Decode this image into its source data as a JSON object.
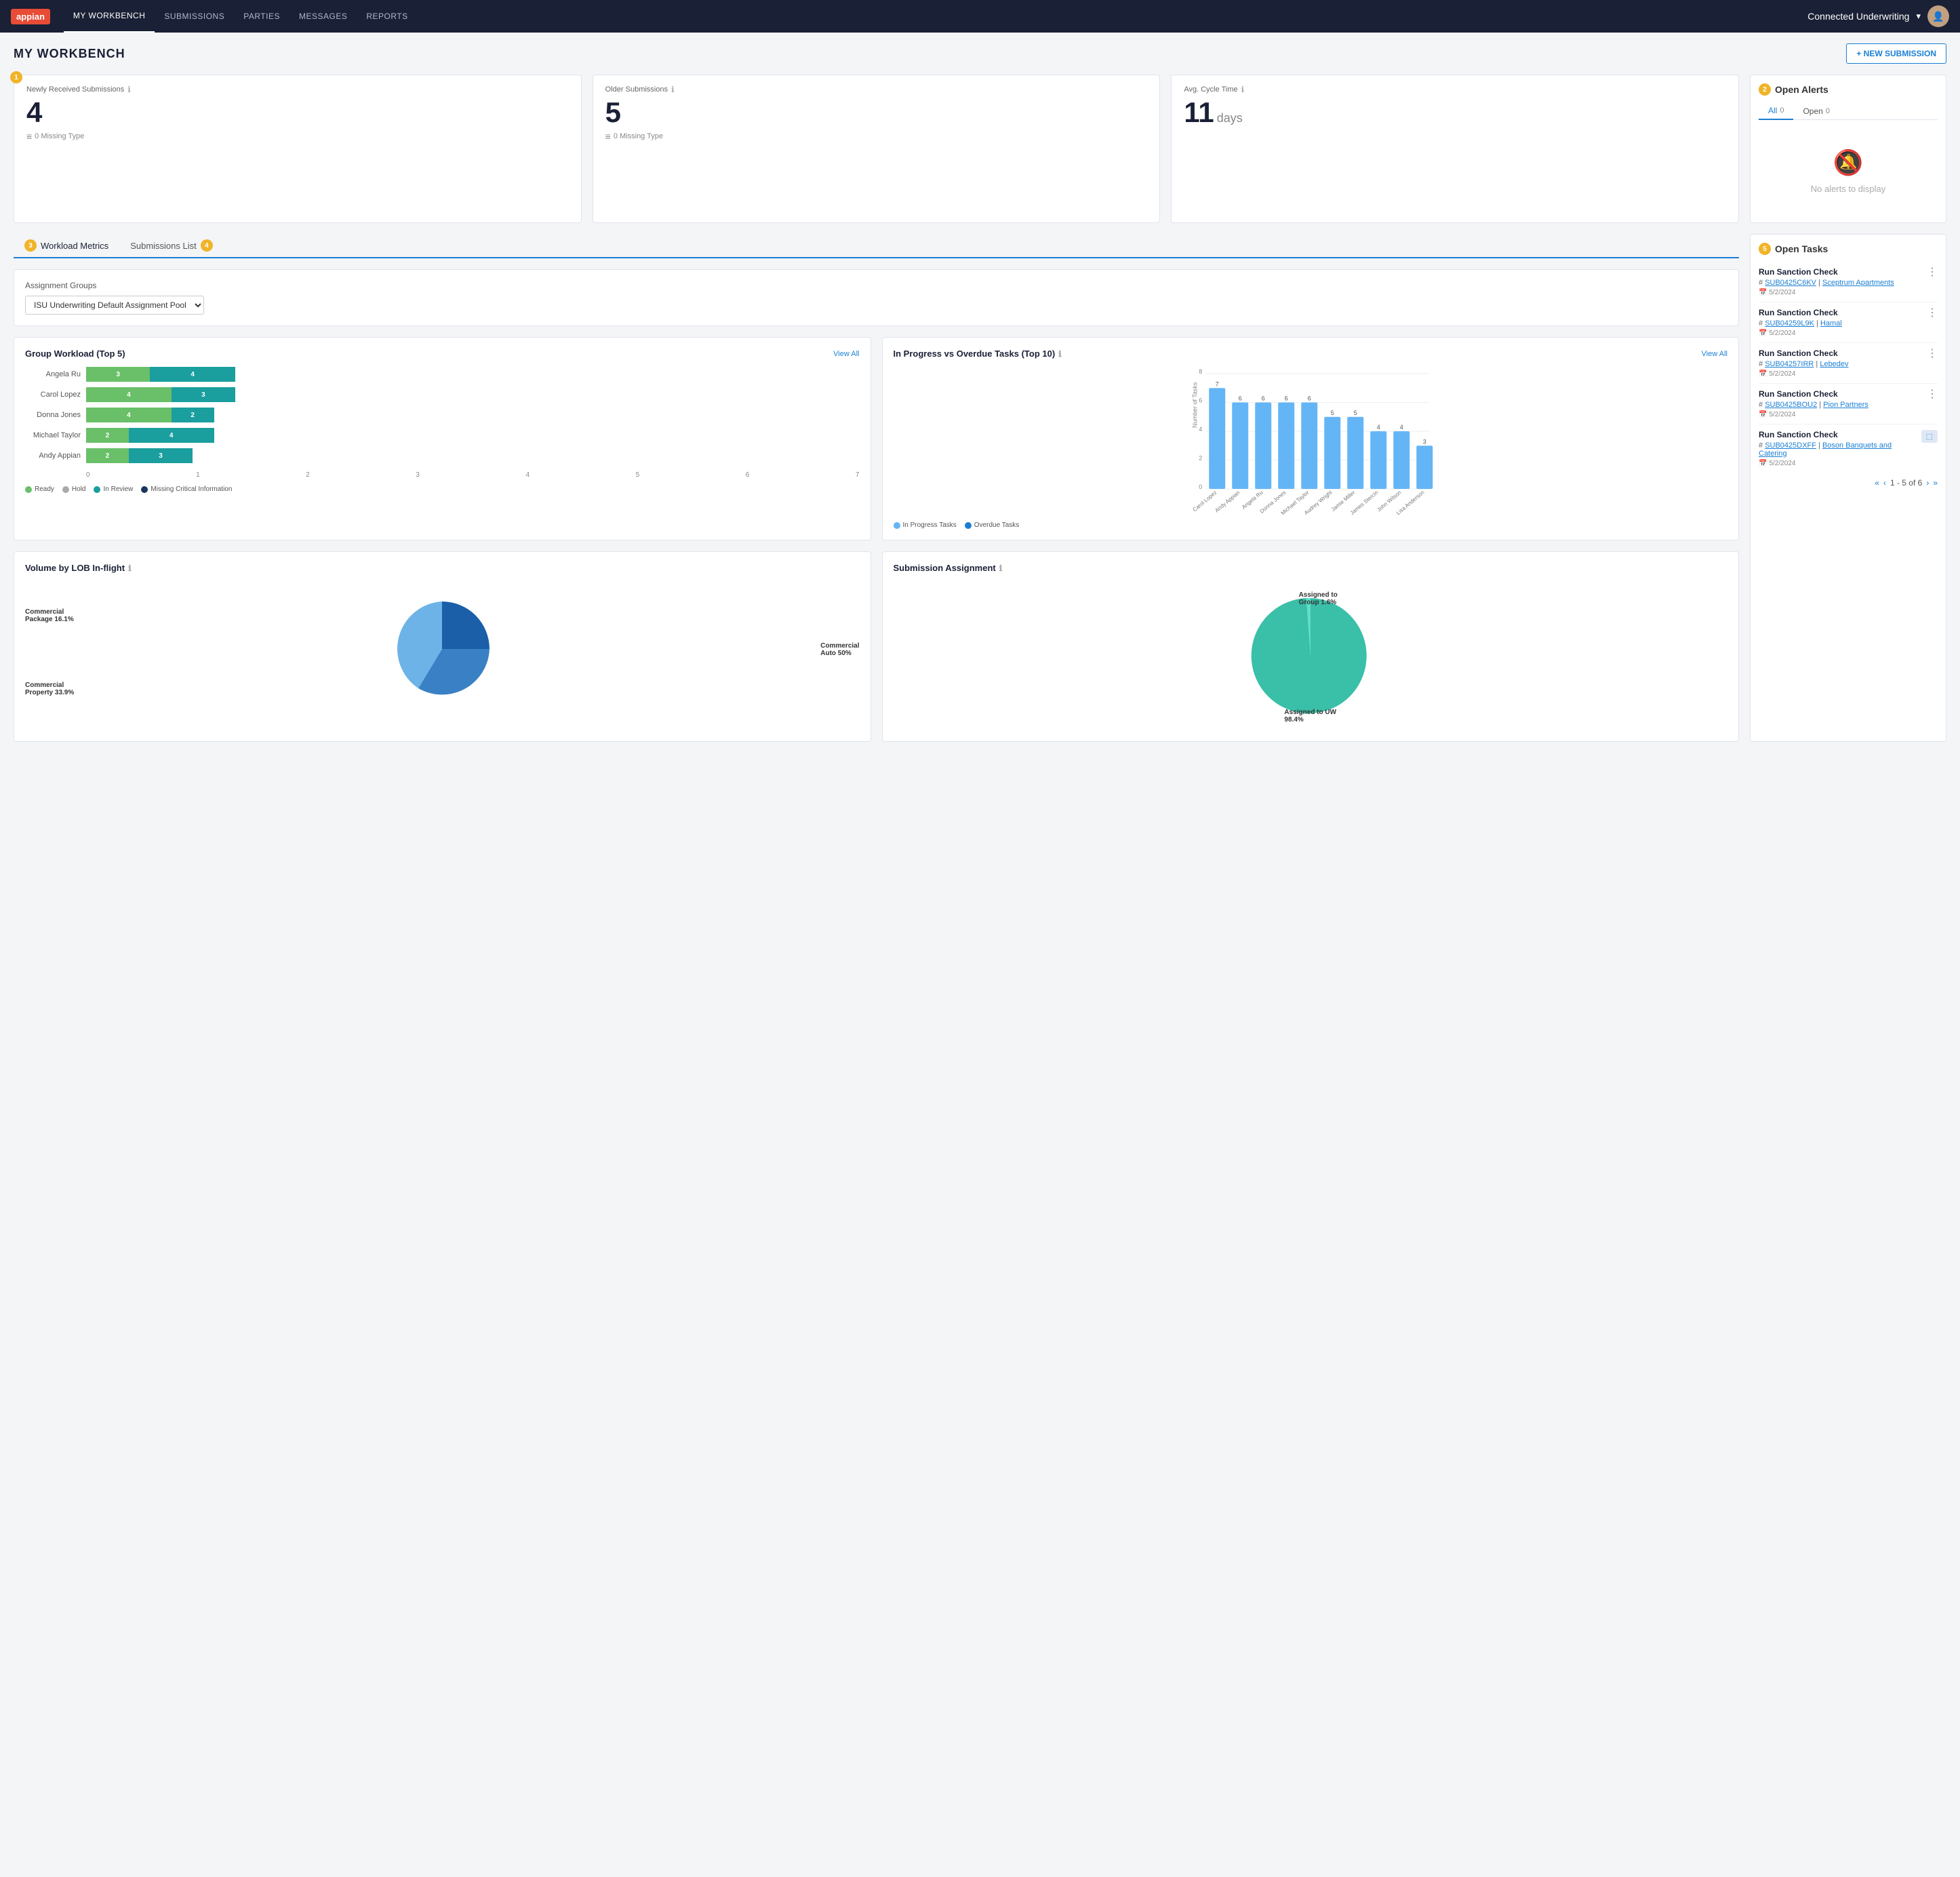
{
  "nav": {
    "logo": "appian",
    "links": [
      "MY WORKBENCH",
      "SUBMISSIONS",
      "PARTIES",
      "MESSAGES",
      "REPORTS"
    ],
    "active_link": "MY WORKBENCH",
    "app_name": "Connected Underwriting",
    "dropdown_arrow": "▾"
  },
  "page": {
    "title": "MY WORKBENCH",
    "new_submission_btn": "+ NEW SUBMISSION"
  },
  "stats": {
    "badge1": "1",
    "badge2": "2",
    "newly_received": {
      "title": "Newly Received Submissions",
      "number": "4",
      "sub": "0 Missing Type"
    },
    "older_submissions": {
      "title": "Older Submissions",
      "number": "5",
      "sub": "0 Missing Type"
    },
    "avg_cycle": {
      "title": "Avg. Cycle Time",
      "number": "11",
      "unit": "days"
    }
  },
  "tabs": {
    "workload_metrics": "Workload Metrics",
    "workload_badge": "3",
    "submissions_list": "Submissions List",
    "submissions_badge": "4"
  },
  "workload": {
    "assignment_groups_label": "Assignment Groups",
    "assignment_pool": "ISU Underwriting Default Assignment Pool",
    "group_workload_title": "Group Workload (Top 5)",
    "view_all": "View All",
    "bars": [
      {
        "name": "Angela Ru",
        "ready": 3,
        "review": 4
      },
      {
        "name": "Carol Lopez",
        "ready": 4,
        "review": 3
      },
      {
        "name": "Donna Jones",
        "ready": 4,
        "review": 2
      },
      {
        "name": "Michael Taylor",
        "ready": 2,
        "review": 4
      },
      {
        "name": "Andy Appian",
        "ready": 2,
        "review": 3
      }
    ],
    "x_labels": [
      "0",
      "1",
      "2",
      "3",
      "4",
      "5",
      "6",
      "7"
    ],
    "legend": [
      "Ready",
      "Hold",
      "In Review",
      "Missing Critical Information"
    ]
  },
  "in_progress": {
    "title": "In Progress vs Overdue Tasks (Top 10)",
    "view_all": "View All",
    "columns": [
      "Carol Lopez",
      "Andy Appian",
      "Angela Ru",
      "Donna Jones",
      "Michael Taylor",
      "Audrey Wright",
      "Jamie Miller",
      "James Stercin",
      "John Wilson",
      "Lisa Anderson"
    ],
    "in_progress": [
      7,
      6,
      6,
      6,
      6,
      5,
      5,
      4,
      4,
      3
    ],
    "overdue": [
      0,
      0,
      0,
      0,
      0,
      0,
      0,
      0,
      0,
      0
    ],
    "y_labels": [
      "0",
      "2",
      "4",
      "6",
      "8"
    ],
    "legend_in_progress": "In Progress Tasks",
    "legend_overdue": "Overdue Tasks"
  },
  "lob": {
    "title": "Volume by LOB In-flight",
    "slices": [
      {
        "label": "Commercial Auto 50%",
        "percent": 50,
        "color": "#1a5fa8"
      },
      {
        "label": "Commercial Package 16.1%",
        "percent": 16.1,
        "color": "#6db3e8"
      },
      {
        "label": "Commercial Property 33.9%",
        "percent": 33.9,
        "color": "#3a80c4"
      }
    ]
  },
  "submission_assignment": {
    "title": "Submission Assignment",
    "slices": [
      {
        "label": "Assigned to UW 98.4%",
        "percent": 98.4,
        "color": "#3abfa8"
      },
      {
        "label": "Assigned to Group 1.6%",
        "percent": 1.6,
        "color": "#5de0c8"
      }
    ]
  },
  "alerts": {
    "title": "Open Alerts",
    "badge": "2",
    "tabs": [
      {
        "label": "All",
        "count": "0"
      },
      {
        "label": "Open",
        "count": "0"
      }
    ],
    "active_tab": "All",
    "no_alerts_text": "No alerts to display"
  },
  "open_tasks": {
    "title": "Open Tasks",
    "badge": "5",
    "tasks": [
      {
        "name": "Run Sanction Check",
        "id": "SUB0425C6KV",
        "company": "Sceptrum Apartments",
        "date": "5/2/2024",
        "has_action": false
      },
      {
        "name": "Run Sanction Check",
        "id": "SUB04259L9K",
        "company": "Hamal",
        "date": "5/2/2024",
        "has_action": false
      },
      {
        "name": "Run Sanction Check",
        "id": "SUB04257IRR",
        "company": "Lebedev",
        "date": "5/2/2024",
        "has_action": false
      },
      {
        "name": "Run Sanction Check",
        "id": "SUB0425BOU2",
        "company": "Pion Partners",
        "date": "5/2/2024",
        "has_action": false
      },
      {
        "name": "Run Sanction Check",
        "id": "SUB0425DXFF",
        "company": "Boson Banquets and Catering",
        "date": "5/2/2024",
        "has_action": true
      }
    ],
    "pagination": "1 - 5 of 6"
  }
}
